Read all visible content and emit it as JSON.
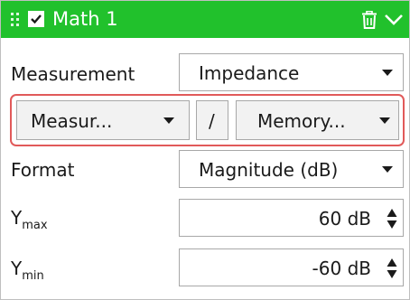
{
  "header": {
    "title": "Math 1",
    "checked": true,
    "accent_color": "#21c12c",
    "icons": [
      "drag-grip-icon",
      "checkbox-checked-icon",
      "trash-icon",
      "chevron-down-icon"
    ]
  },
  "measurement": {
    "label": "Measurement",
    "value": "Impedance"
  },
  "ratio": {
    "numerator": "Measur...",
    "operator": "/",
    "denominator": "Memory...",
    "highlight_color": "#e15a5a"
  },
  "format": {
    "label": "Format",
    "value": "Magnitude (dB)"
  },
  "ymax": {
    "label_main": "Y",
    "label_sub": "max",
    "value": "60 dB"
  },
  "ymin": {
    "label_main": "Y",
    "label_sub": "min",
    "value": "-60 dB"
  }
}
